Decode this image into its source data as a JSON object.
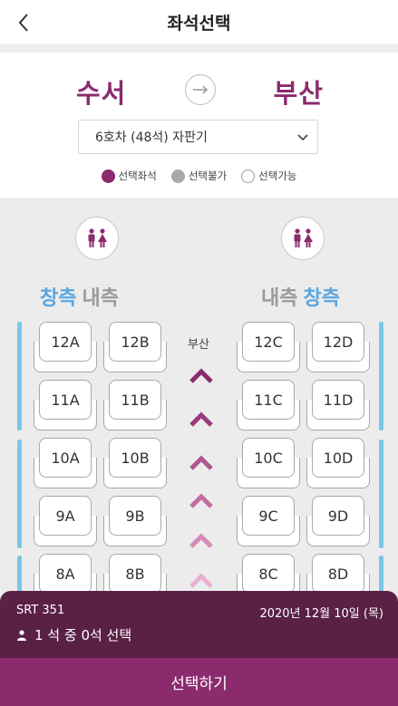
{
  "header": {
    "title": "좌석선택",
    "back_icon": "chevron-left-icon"
  },
  "route": {
    "from": "수서",
    "to": "부산",
    "arrow_icon": "arrow-right-icon",
    "car_select": "6호차 (48석) 자판기",
    "colors": {
      "brand": "#8b2b6e",
      "window": "#5aa6e0"
    }
  },
  "legend": {
    "selected": "선택좌석",
    "unavailable": "선택불가",
    "available": "선택가능"
  },
  "seatmap": {
    "restroom_icon": "restroom-icon",
    "left_labels": {
      "window": "창측",
      "aisle": "내측"
    },
    "right_labels": {
      "aisle": "내측",
      "window": "창측"
    },
    "direction": "부산",
    "rows": [
      [
        "12A",
        "12B",
        "12C",
        "12D"
      ],
      [
        "11A",
        "11B",
        "11C",
        "11D"
      ],
      [
        "10A",
        "10B",
        "10C",
        "10D"
      ],
      [
        "9A",
        "9B",
        "9C",
        "9D"
      ],
      [
        "8A",
        "8B",
        "8C",
        "8D"
      ]
    ]
  },
  "trip": {
    "train": "SRT 351",
    "date": "2020년 12월 10일 (목)",
    "count": "1 석 중 0석 선택"
  },
  "action": {
    "select": "선택하기"
  }
}
